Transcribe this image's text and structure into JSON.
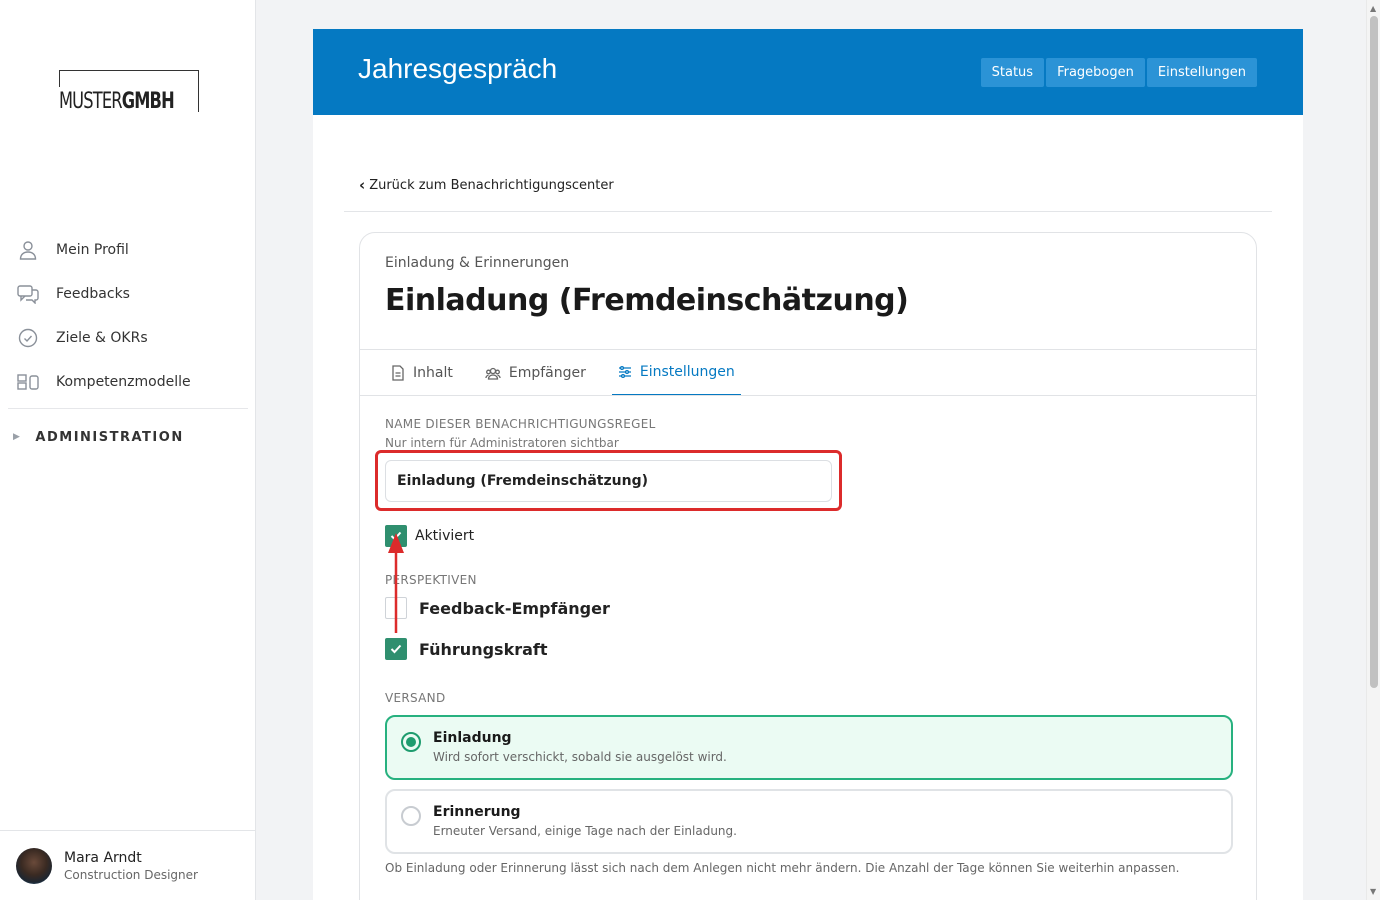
{
  "brand": {
    "logo_light": "MUSTER",
    "logo_bold": "GMBH"
  },
  "sidebar": {
    "items": [
      {
        "label": "Mein Profil",
        "icon": "user-icon"
      },
      {
        "label": "Feedbacks",
        "icon": "chat-bubbles-icon"
      },
      {
        "label": "Ziele & OKRs",
        "icon": "check-circle-icon"
      },
      {
        "label": "Kompetenzmodelle",
        "icon": "blocks-icon"
      }
    ],
    "admin_label": "ADMINISTRATION",
    "user": {
      "name": "Mara Arndt",
      "role": "Construction Designer"
    }
  },
  "header": {
    "title": "Jahresgespräch",
    "buttons": [
      "Status",
      "Fragebogen",
      "Einstellungen"
    ],
    "accent": "#0579c2"
  },
  "back_link": "Zurück zum Benachrichtigungscenter",
  "card": {
    "subtitle": "Einladung & Erinnerungen",
    "title": "Einladung (Fremdeinschätzung)",
    "tabs": [
      {
        "label": "Inhalt",
        "icon": "document-icon",
        "active": false
      },
      {
        "label": "Empfänger",
        "icon": "users-icon",
        "active": false
      },
      {
        "label": "Einstellungen",
        "icon": "sliders-icon",
        "active": true
      }
    ],
    "name_field": {
      "label": "NAME DIESER BENACHRICHTIGUNGSREGEL",
      "hint": "Nur intern für Administratoren sichtbar",
      "value": "Einladung (Fremdeinschätzung)"
    },
    "activated": {
      "label": "Aktiviert",
      "checked": true
    },
    "perspectives": {
      "label": "PERSPEKTIVEN",
      "items": [
        {
          "label": "Feedback-Empfänger",
          "checked": false
        },
        {
          "label": "Führungskraft",
          "checked": true
        }
      ]
    },
    "versand": {
      "label": "VERSAND",
      "options": [
        {
          "title": "Einladung",
          "desc": "Wird sofort verschickt, sobald sie ausgelöst wird.",
          "selected": true
        },
        {
          "title": "Erinnerung",
          "desc": "Erneuter Versand, einige Tage nach der Einladung.",
          "selected": false
        }
      ],
      "note": "Ob Einladung oder Erinnerung lässt sich nach dem Anlegen nicht mehr ändern. Die Anzahl der Tage können Sie weiterhin anpassen."
    }
  },
  "annotation_color": "#dc2b2b"
}
